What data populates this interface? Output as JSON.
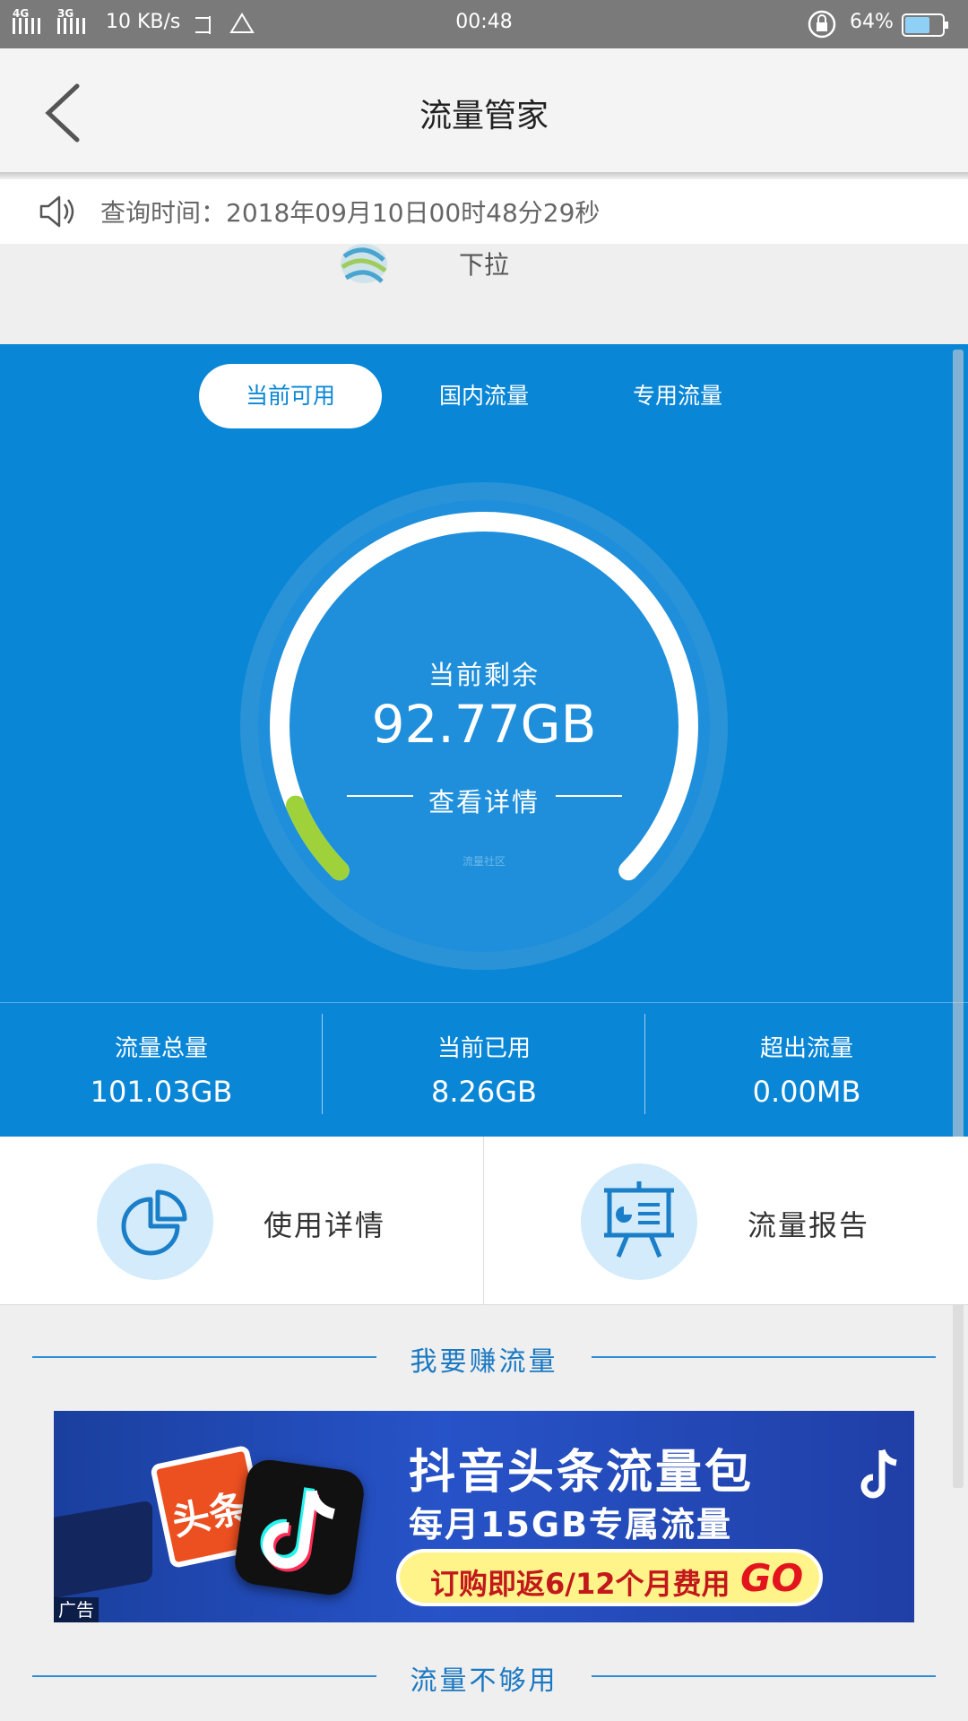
{
  "status_bar": {
    "network_1": "4G",
    "network_2": "3G",
    "speed": "10 KB/s",
    "time": "00:48",
    "battery_pct": "64%"
  },
  "nav": {
    "title": "流量管家"
  },
  "notice": {
    "text": "查询时间：2018年09月10日00时48分29秒"
  },
  "pull": {
    "label": "下拉"
  },
  "tabs": [
    {
      "label": "当前可用",
      "active": true
    },
    {
      "label": "国内流量",
      "active": false
    },
    {
      "label": "专用流量",
      "active": false
    }
  ],
  "gauge": {
    "title": "当前剩余",
    "value": "92.77GB",
    "detail_link": "查看详情",
    "watermark": "流量社区",
    "used_fraction": 0.082
  },
  "stats": [
    {
      "label": "流量总量",
      "value": "101.03GB"
    },
    {
      "label": "当前已用",
      "value": "8.26GB"
    },
    {
      "label": "超出流量",
      "value": "0.00MB"
    }
  ],
  "quick_actions": [
    {
      "label": "使用详情",
      "icon": "pie-chart-icon"
    },
    {
      "label": "流量报告",
      "icon": "presentation-board-icon"
    }
  ],
  "sections": {
    "earn": "我要赚流量",
    "not_enough": "流量不够用"
  },
  "ad": {
    "headline": "抖音头条流量包",
    "subline": "每月15GB专属流量",
    "cta": "订购即返6/12个月费用",
    "go": "GO",
    "tag": "广告",
    "toutiao_logo_text": "头条"
  },
  "colors": {
    "primary_blue": "#0a86d6",
    "used_green": "#9fd23a",
    "accent_text": "#1b78c2"
  }
}
